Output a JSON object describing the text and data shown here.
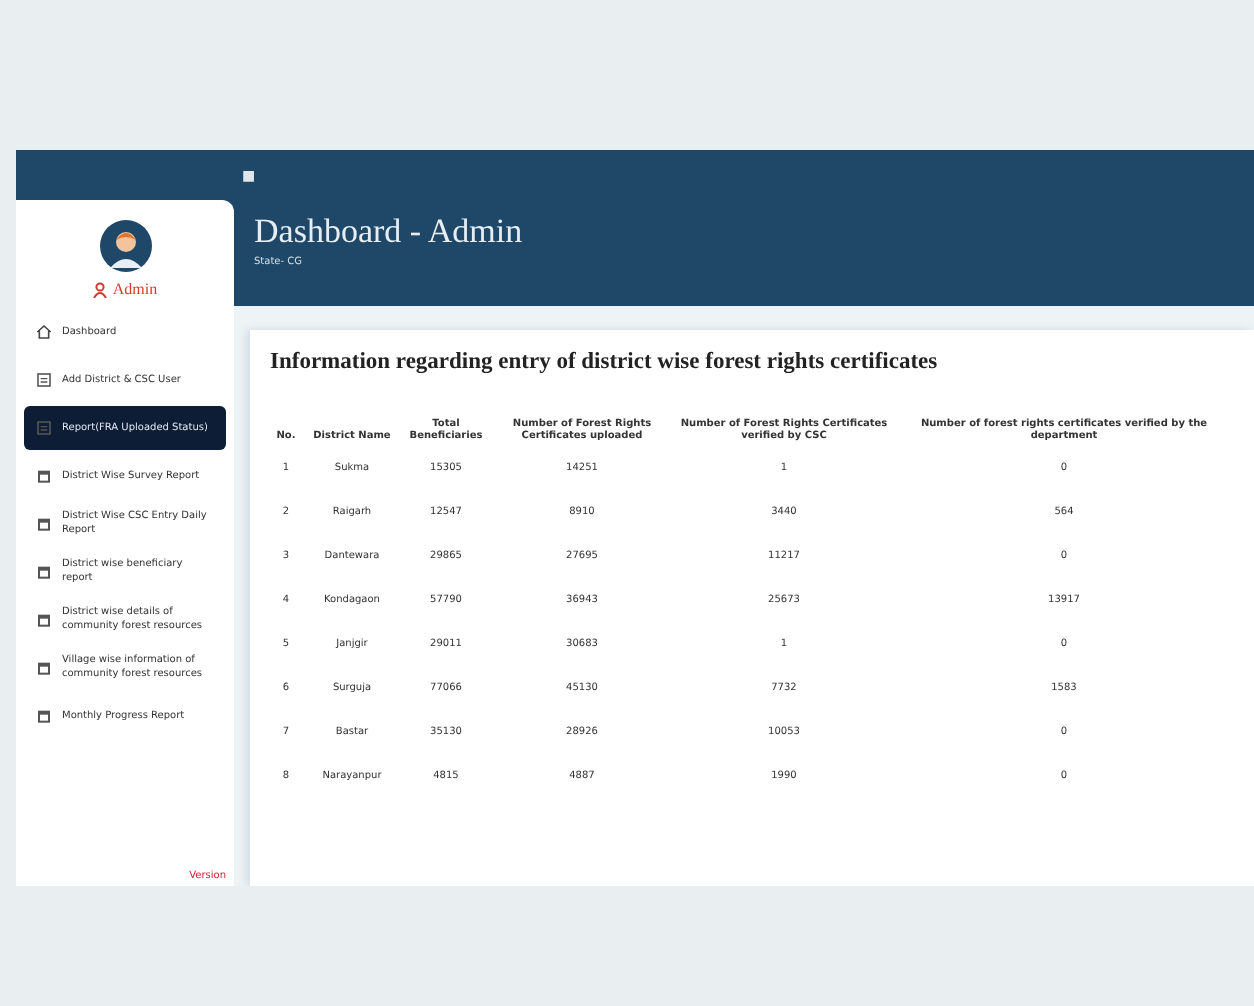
{
  "topbar": {
    "menu_glyph": "■"
  },
  "header": {
    "title": "Dashboard - Admin",
    "subtitle": "State- CG"
  },
  "sidebar": {
    "user": "Admin",
    "items": [
      {
        "label": "Dashboard",
        "kind": "home",
        "selected": false
      },
      {
        "label": "Add District & CSC User",
        "kind": "form",
        "selected": false
      },
      {
        "label": "Report(FRA Uploaded Status)",
        "kind": "form",
        "selected": true
      },
      {
        "label": "District Wise Survey Report",
        "kind": "doc",
        "selected": false
      },
      {
        "label": "District Wise CSC Entry Daily Report",
        "kind": "doc",
        "selected": false
      },
      {
        "label": "District wise beneficiary report",
        "kind": "doc",
        "selected": false
      },
      {
        "label": "District wise details of community forest resources",
        "kind": "doc",
        "selected": false
      },
      {
        "label": "Village wise information of community forest resources",
        "kind": "doc",
        "selected": false
      },
      {
        "label": "Monthly Progress Report",
        "kind": "doc",
        "selected": false
      }
    ],
    "version": "Version"
  },
  "panel": {
    "title": "Information regarding entry of district wise forest rights certificates"
  },
  "table": {
    "columns": [
      "No.",
      "District Name",
      "Total Beneficiaries",
      "Number of Forest Rights Certificates uploaded",
      "Number of Forest Rights Certificates verified by CSC",
      "Number of forest rights certificates verified by the department"
    ],
    "rows": [
      [
        "1",
        "Sukma",
        "15305",
        "14251",
        "1",
        "0"
      ],
      [
        "2",
        "Raigarh",
        "12547",
        "8910",
        "3440",
        "564"
      ],
      [
        "3",
        "Dantewara",
        "29865",
        "27695",
        "11217",
        "0"
      ],
      [
        "4",
        "Kondagaon",
        "57790",
        "36943",
        "25673",
        "13917"
      ],
      [
        "5",
        "Janjgir",
        "29011",
        "30683",
        "1",
        "0"
      ],
      [
        "6",
        "Surguja",
        "77066",
        "45130",
        "7732",
        "1583"
      ],
      [
        "7",
        "Bastar",
        "35130",
        "28926",
        "10053",
        "0"
      ],
      [
        "8",
        "Narayanpur",
        "4815",
        "4887",
        "1990",
        "0"
      ]
    ]
  }
}
